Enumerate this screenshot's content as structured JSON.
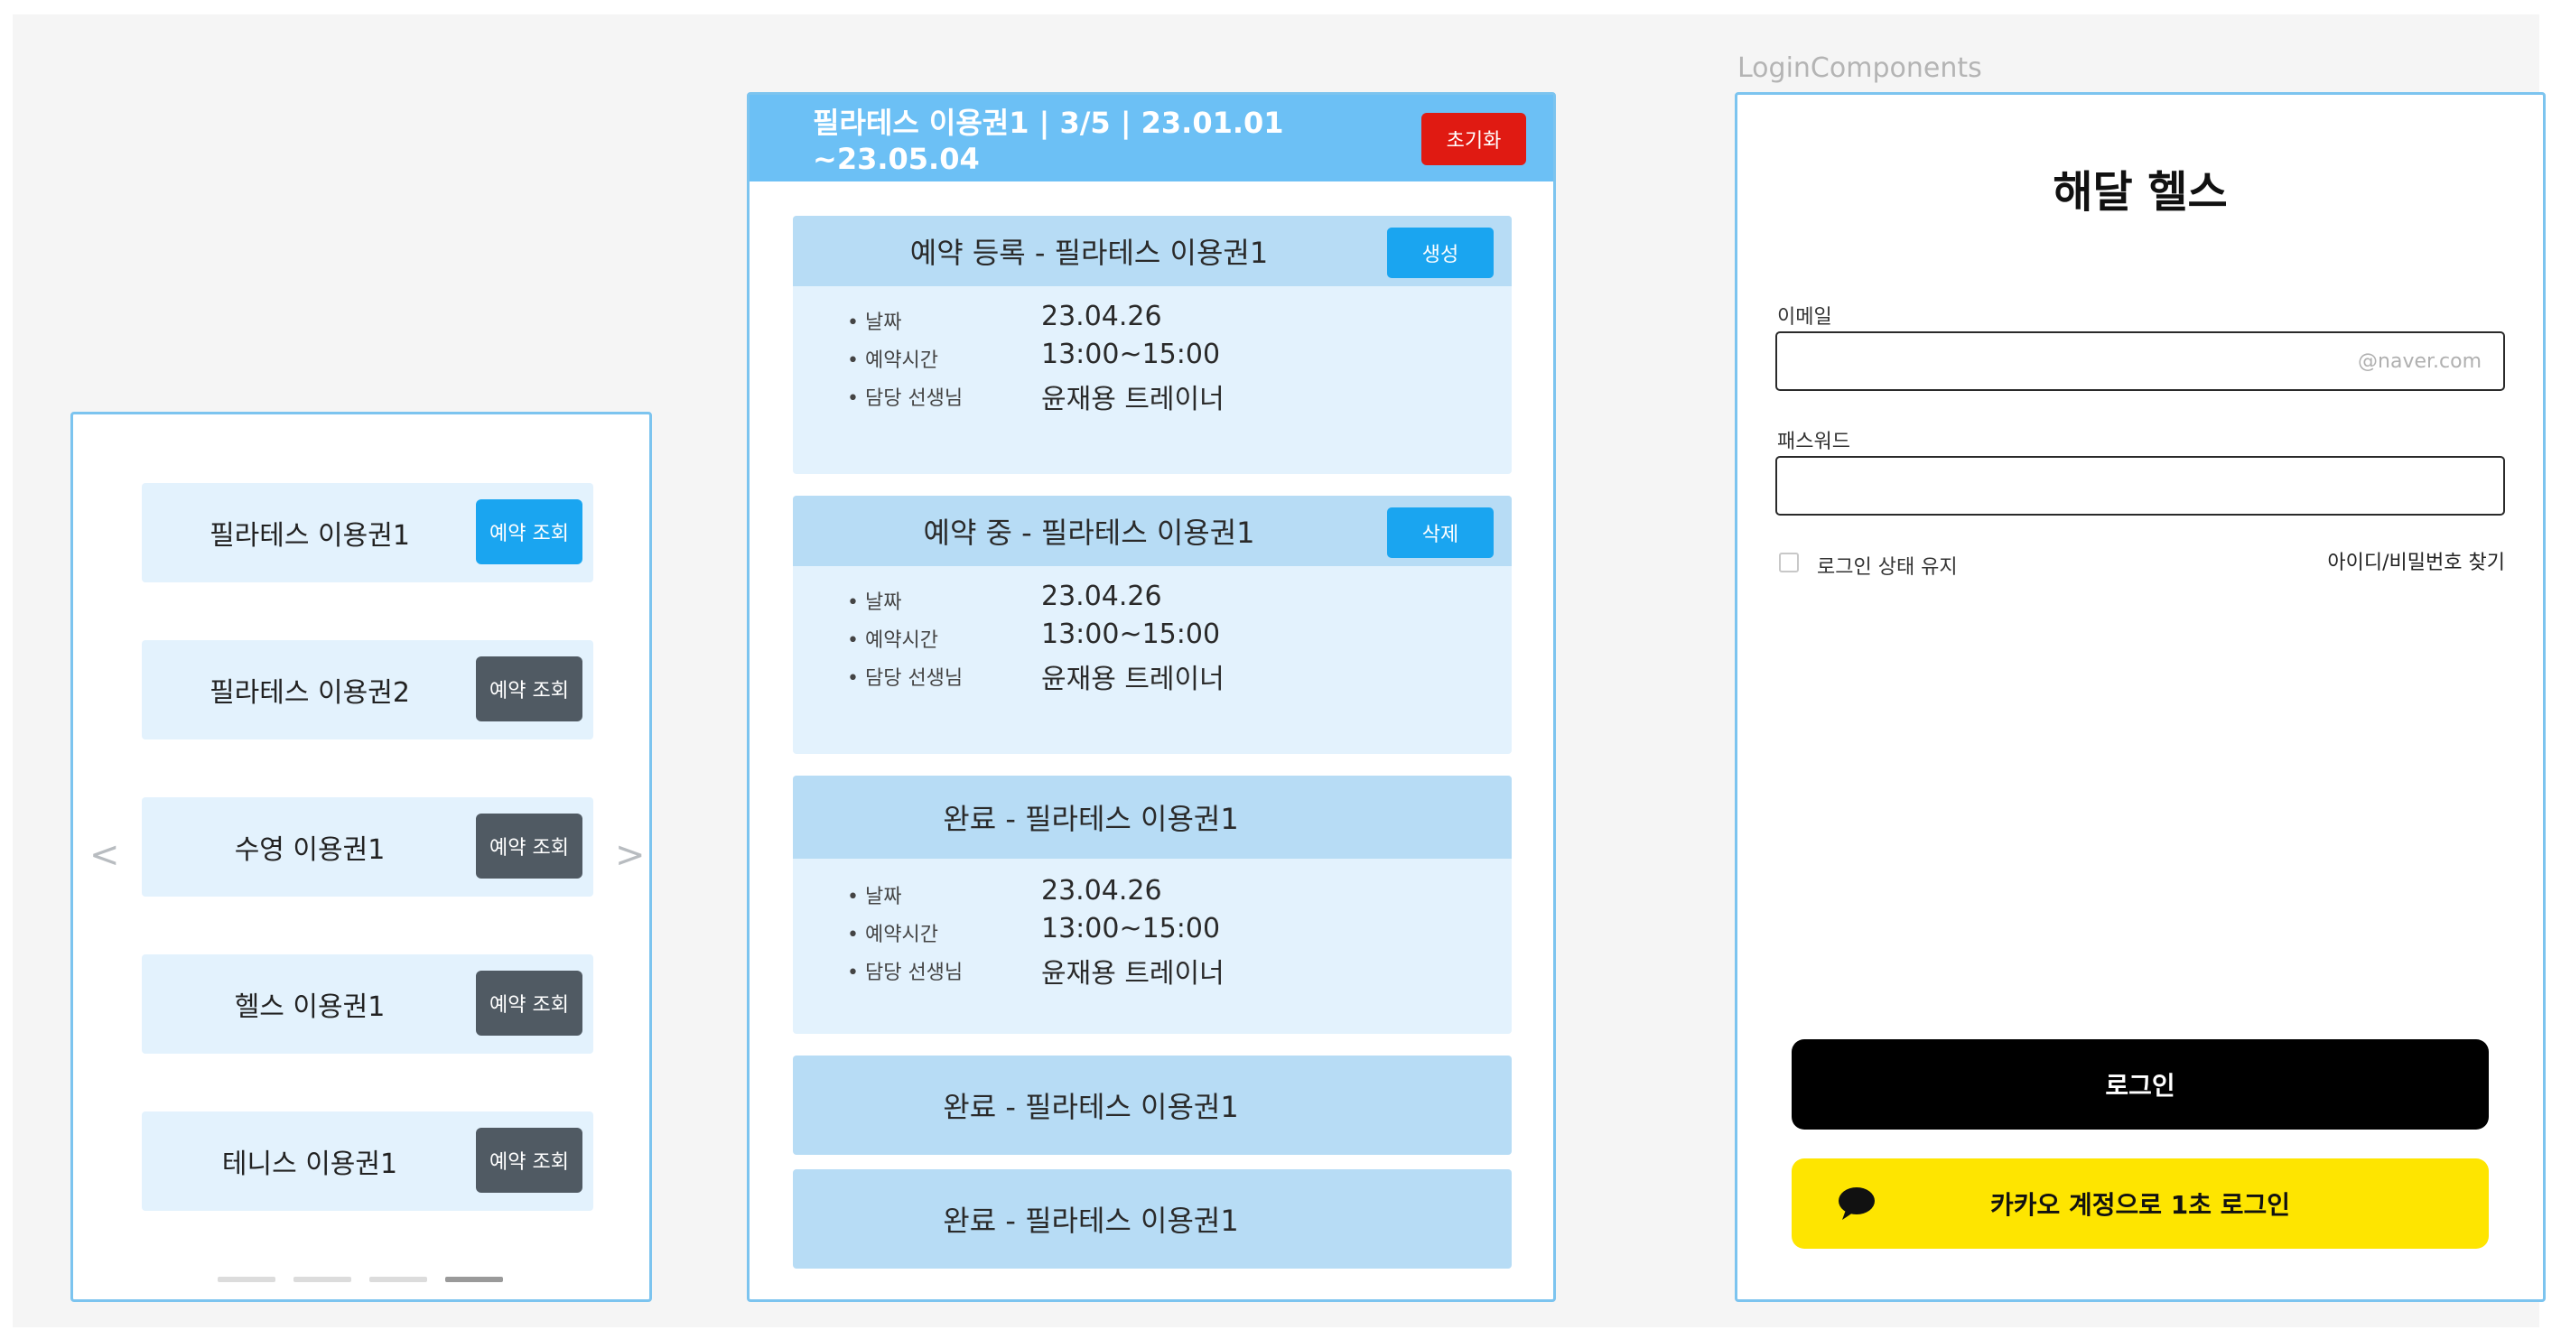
{
  "left": {
    "passes": [
      {
        "name": "필라테스 이용권1",
        "button": "예약 조회",
        "active": true
      },
      {
        "name": "필라테스 이용권2",
        "button": "예약 조회",
        "active": false
      },
      {
        "name": "수영 이용권1",
        "button": "예약 조회",
        "active": false
      },
      {
        "name": "헬스 이용권1",
        "button": "예약 조회",
        "active": false
      },
      {
        "name": "테니스 이용권1",
        "button": "예약 조회",
        "active": false
      }
    ],
    "prev_arrow": "<",
    "next_arrow": ">",
    "page_indicator": {
      "count": 4,
      "active_index": 3
    }
  },
  "middle": {
    "header_title": "필라테스 이용권1 | 3/5 | 23.01.01 ~23.05.04",
    "reset_label": "초기화",
    "reservations": [
      {
        "title": "예약 등록 - 필라테스 이용권1",
        "action": "생성",
        "details": [
          {
            "label": "• 날짜",
            "value": "23.04.26"
          },
          {
            "label": "• 예약시간",
            "value": "13:00~15:00"
          },
          {
            "label": "• 담당 선생님",
            "value": "윤재용 트레이너"
          }
        ]
      },
      {
        "title": "예약 중 - 필라테스 이용권1",
        "action": "삭제",
        "details": [
          {
            "label": "• 날짜",
            "value": "23.04.26"
          },
          {
            "label": "• 예약시간",
            "value": "13:00~15:00"
          },
          {
            "label": "• 담당 선생님",
            "value": "윤재용 트레이너"
          }
        ]
      },
      {
        "title": "완료 - 필라테스 이용권1",
        "details": [
          {
            "label": "• 날짜",
            "value": "23.04.26"
          },
          {
            "label": "• 예약시간",
            "value": "13:00~15:00"
          },
          {
            "label": "• 담당 선생님",
            "value": "윤재용 트레이너"
          }
        ]
      }
    ],
    "collapsed": [
      {
        "title": "완료 - 필라테스 이용권1"
      },
      {
        "title": "완료 - 필라테스 이용권1"
      }
    ]
  },
  "right": {
    "frame_caption": "LoginComponents",
    "app_title": "해달 헬스",
    "email_label": "이메일",
    "email_placeholder": "@naver.com",
    "password_label": "패스워드",
    "keep_login_label": "로그인 상태 유지",
    "find_account_link": "아이디/비밀번호 찾기",
    "login_button": "로그인",
    "kakao_button": "카카오 계정으로 1초 로그인",
    "kakao_icon": "speech-bubble-icon"
  },
  "colors": {
    "accent_blue": "#1aa5f0",
    "header_blue": "#6cc0f5",
    "card_light": "#e3f2fd",
    "card_head": "#b7dcf5",
    "reset_red": "#e01a12",
    "kakao_yellow": "#fee500",
    "dark_button": "#505a63"
  }
}
